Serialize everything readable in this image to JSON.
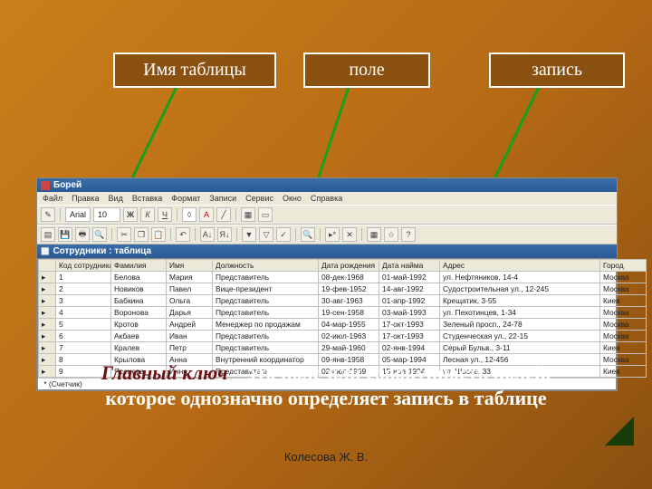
{
  "labels": {
    "table_name": "Имя таблицы",
    "field": "поле",
    "record": "запись"
  },
  "app": {
    "title": "Борей",
    "menu": [
      "Файл",
      "Правка",
      "Вид",
      "Вставка",
      "Формат",
      "Записи",
      "Сервис",
      "Окно",
      "Справка"
    ],
    "toolbar1": {
      "font_name": "Arial",
      "font_size": "10"
    },
    "inner_title": "Сотрудники : таблица",
    "columns": [
      "",
      "Код сотрудника",
      "Фамилия",
      "Имя",
      "Должность",
      "Дата рождения",
      "Дата найма",
      "Адрес",
      "Город"
    ],
    "rows": [
      [
        "1",
        "Белова",
        "Мария",
        "Представитель",
        "08-дек-1968",
        "01-май-1992",
        "ул. Нефтяников, 14-4",
        "Москва"
      ],
      [
        "2",
        "Новиков",
        "Павел",
        "Вице-президент",
        "19-фев-1952",
        "14-авг-1992",
        "Судостроительная ул., 12-245",
        "Москва"
      ],
      [
        "3",
        "Бабкина",
        "Ольга",
        "Представитель",
        "30-авг-1963",
        "01-апр-1992",
        "Крещатик, 3-55",
        "Киев"
      ],
      [
        "4",
        "Воронова",
        "Дарья",
        "Представитель",
        "19-сен-1958",
        "03-май-1993",
        "ул. Пехотинцев, 1-34",
        "Москва"
      ],
      [
        "5",
        "Кротов",
        "Андрей",
        "Менеджер по продажам",
        "04-мар-1955",
        "17-окт-1993",
        "Зеленый просп., 24-78",
        "Москва"
      ],
      [
        "6",
        "Акбаев",
        "Иван",
        "Представитель",
        "02-июл-1963",
        "17-окт-1993",
        "Студенческая ул., 22-15",
        "Москва"
      ],
      [
        "7",
        "Кралев",
        "Петр",
        "Представитель",
        "29-май-1960",
        "02-янв-1994",
        "Серый Бульв., 3-11",
        "Киев"
      ],
      [
        "8",
        "Крылова",
        "Анна",
        "Внутренний координатор",
        "09-янв-1958",
        "05-мар-1994",
        "Лесная ул., 12-456",
        "Москва"
      ],
      [
        "9",
        "Ясенева",
        "Инна",
        "Представитель",
        "02-июл-1969",
        "15-ноя-1994",
        "ул. Шоссе, 33",
        "Киев"
      ]
    ],
    "footer": "(Счетчик)"
  },
  "definition": {
    "keyword": "Главный ключ",
    "rest1": " – это поле или совокупность полей,",
    "rest2": "которое однозначно определяет запись в таблице"
  },
  "credit": "Колесова Ж. В."
}
